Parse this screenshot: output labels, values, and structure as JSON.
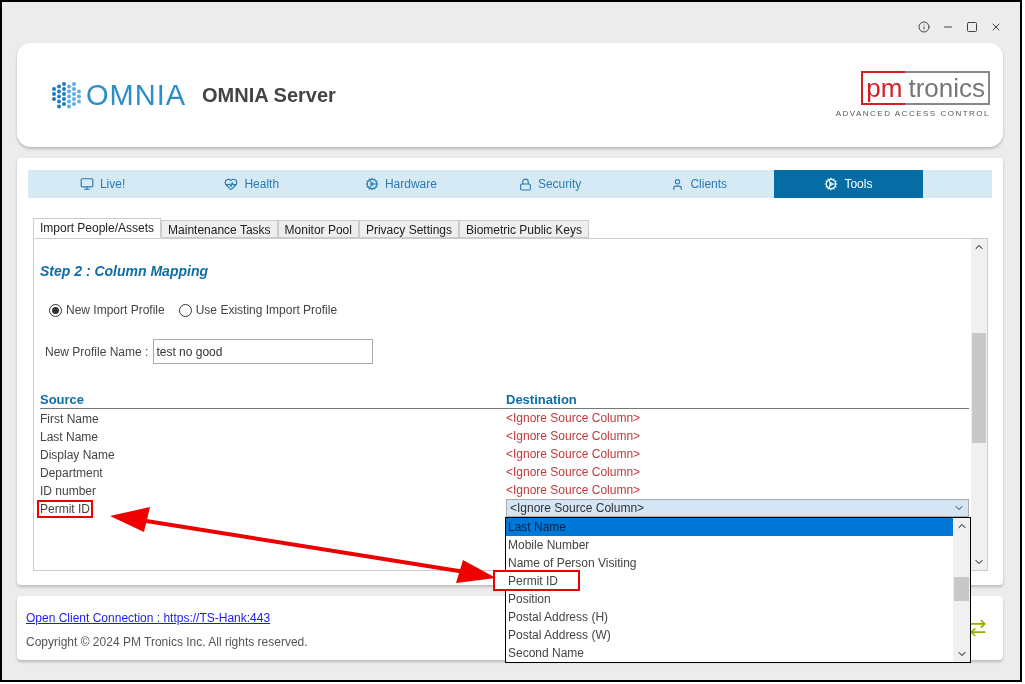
{
  "header": {
    "logo_text": "OMNIA",
    "title": "OMNIA Server",
    "brand": {
      "name_a": "pm",
      "name_b": "tronics",
      "tagline": "ADVANCED ACCESS CONTROL"
    }
  },
  "nav_tabs": [
    {
      "label": "Live!",
      "selected": false
    },
    {
      "label": "Health",
      "selected": false
    },
    {
      "label": "Hardware",
      "selected": false
    },
    {
      "label": "Security",
      "selected": false
    },
    {
      "label": "Clients",
      "selected": false
    },
    {
      "label": "Tools",
      "selected": true
    }
  ],
  "sub_tabs": [
    {
      "label": "Import People/Assets",
      "selected": true
    },
    {
      "label": "Maintenance Tasks",
      "selected": false
    },
    {
      "label": "Monitor Pool",
      "selected": false
    },
    {
      "label": "Privacy Settings",
      "selected": false
    },
    {
      "label": "Biometric Public Keys",
      "selected": false
    }
  ],
  "step_title": "Step 2 : Column Mapping",
  "profile_options": [
    {
      "label": "New Import Profile",
      "selected": true
    },
    {
      "label": "Use Existing Import Profile",
      "selected": false
    }
  ],
  "profile_name": {
    "label": "New Profile Name :",
    "value": "test no good"
  },
  "mapping": {
    "columns": [
      "Source",
      "Destination"
    ],
    "rows": [
      {
        "source": "First Name",
        "destination": "<Ignore Source Column>",
        "kind": "text",
        "highlighted": false
      },
      {
        "source": "Last Name",
        "destination": "<Ignore Source Column>",
        "kind": "text",
        "highlighted": false
      },
      {
        "source": "Display Name",
        "destination": "<Ignore Source Column>",
        "kind": "text",
        "highlighted": false
      },
      {
        "source": "Department",
        "destination": "<Ignore Source Column>",
        "kind": "text",
        "highlighted": false
      },
      {
        "source": "ID number",
        "destination": "<Ignore Source Column>",
        "kind": "text",
        "highlighted": false
      },
      {
        "source": "Permit ID",
        "destination": "<Ignore Source Column>",
        "kind": "select",
        "highlighted": true
      }
    ]
  },
  "dropdown": {
    "items": [
      {
        "label": "Last Name",
        "selected": true,
        "highlighted": false
      },
      {
        "label": "Mobile Number",
        "selected": false,
        "highlighted": false
      },
      {
        "label": "Name of Person Visiting",
        "selected": false,
        "highlighted": false
      },
      {
        "label": "Permit ID",
        "selected": false,
        "highlighted": true
      },
      {
        "label": "Position",
        "selected": false,
        "highlighted": false
      },
      {
        "label": "Postal Address (H)",
        "selected": false,
        "highlighted": false
      },
      {
        "label": "Postal Address (W)",
        "selected": false,
        "highlighted": false
      },
      {
        "label": "Second Name",
        "selected": false,
        "highlighted": false
      }
    ]
  },
  "footer": {
    "link": "Open Client Connection : https://TS-Hank:443",
    "copyright": "Copyright © 2024 PM Tronics Inc. All rights reserved."
  }
}
